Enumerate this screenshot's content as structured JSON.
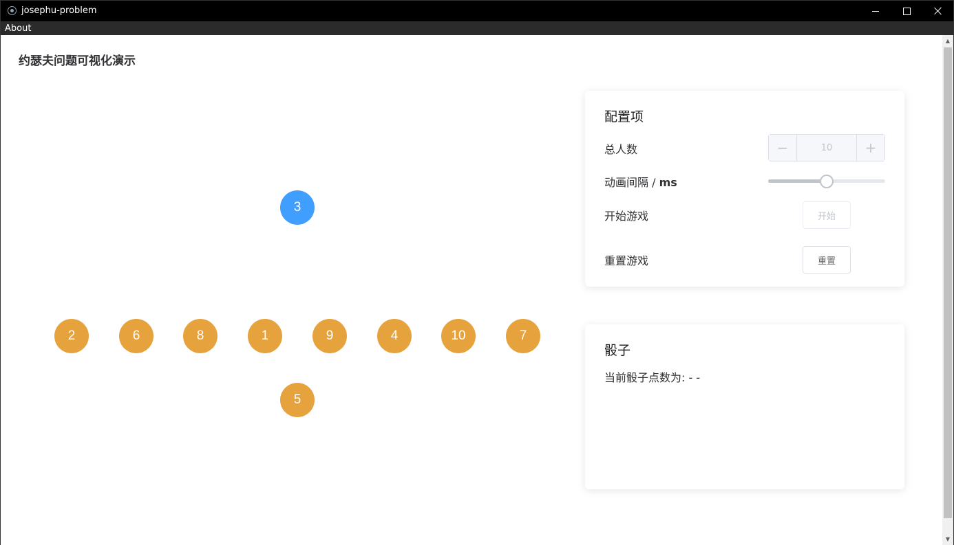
{
  "window": {
    "title": "josephu-problem",
    "menu_about": "About"
  },
  "page": {
    "title": "约瑟夫问题可视化演示"
  },
  "people": [
    {
      "label": "3",
      "state": "active"
    },
    {
      "label": "2",
      "state": "waiting"
    },
    {
      "label": "6",
      "state": "waiting"
    },
    {
      "label": "8",
      "state": "waiting"
    },
    {
      "label": "1",
      "state": "waiting"
    },
    {
      "label": "9",
      "state": "waiting"
    },
    {
      "label": "4",
      "state": "waiting"
    },
    {
      "label": "10",
      "state": "waiting"
    },
    {
      "label": "7",
      "state": "waiting"
    },
    {
      "label": "5",
      "state": "waiting"
    }
  ],
  "config": {
    "title": "配置项",
    "total_label": "总人数",
    "total_value": "10",
    "total_dec": "−",
    "total_inc": "+",
    "interval_label_prefix": "动画间隔 / ",
    "interval_label_unit": "ms",
    "interval_level": 0.5,
    "start_label": "开始游戏",
    "start_button": "开始",
    "reset_label": "重置游戏",
    "reset_button": "重置"
  },
  "dice": {
    "title": "骰子",
    "current_text": "当前骰子点数为: - -"
  },
  "colors": {
    "active": "#409eff",
    "waiting": "#e6a23c"
  }
}
